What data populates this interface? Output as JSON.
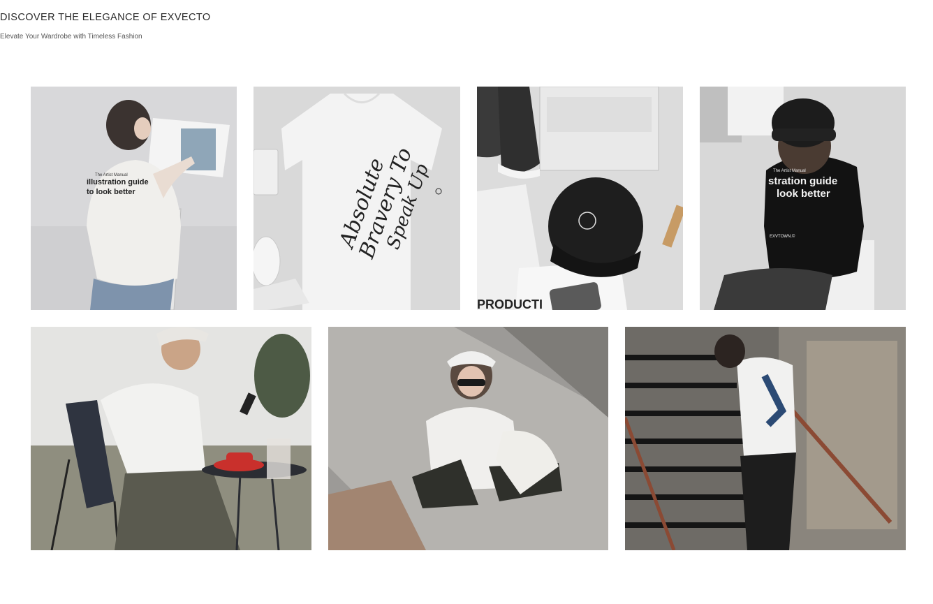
{
  "header": {
    "title": "DISCOVER THE ELEGANCE OF EXVECTO",
    "subtitle": "Elevate Your Wardrobe with Timeless Fashion"
  },
  "gallery": {
    "tiles": [
      {
        "print_lines": [
          "The Artist Manual",
          "illustration guide",
          "to look better"
        ]
      },
      {
        "print_lines": [
          "Absolute",
          "Bravery To",
          "Speak Up"
        ]
      },
      {
        "print_lines": [
          "PRODUCTI"
        ]
      },
      {
        "print_lines": [
          "The Artist Manual",
          "stration guide",
          "look better",
          "EXVTOWN.©"
        ]
      },
      {
        "print_lines": []
      },
      {
        "print_lines": []
      },
      {
        "print_lines": []
      }
    ]
  }
}
